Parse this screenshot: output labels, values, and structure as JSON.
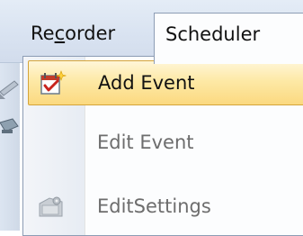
{
  "menubar": {
    "recorder": {
      "prefix": "Re",
      "mnemonic": "c",
      "suffix": "order"
    },
    "scheduler_label": "Scheduler"
  },
  "dropdown": {
    "items": [
      {
        "label": "Add Event",
        "icon": "calendar-add-icon",
        "state": "highlighted"
      },
      {
        "label": "Edit Event",
        "icon": "",
        "state": "disabled"
      },
      {
        "label": "EditSettings",
        "icon": "settings-folder-icon",
        "state": "disabled"
      }
    ]
  },
  "colors": {
    "highlight_top": "#fff6d8",
    "highlight_bottom": "#fbd980",
    "highlight_border": "#d4a43a",
    "disabled_text": "#6d6d6d",
    "menu_border": "#8d9db5"
  }
}
